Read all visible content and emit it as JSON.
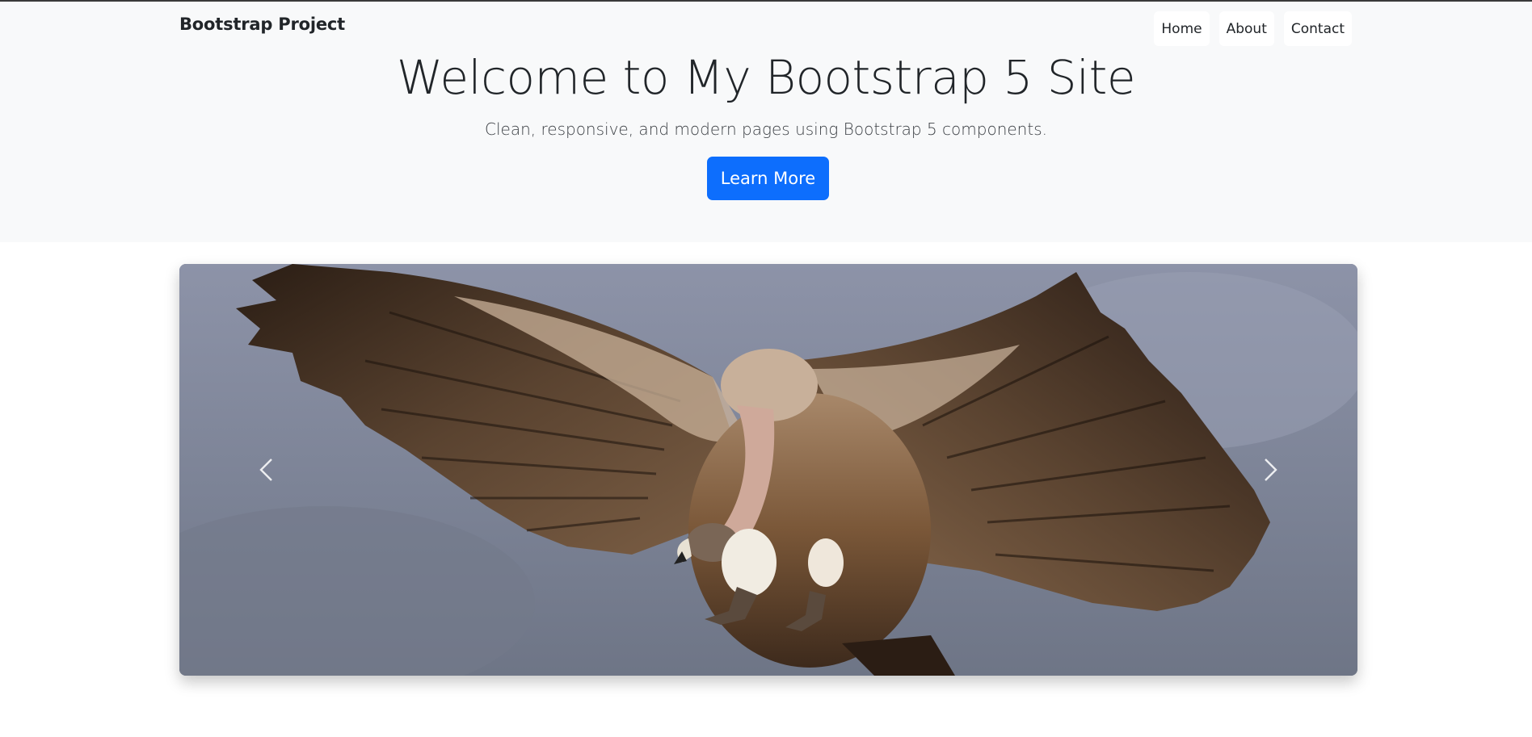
{
  "navbar": {
    "brand": "Bootstrap Project",
    "links": [
      "Home",
      "About",
      "Contact"
    ]
  },
  "hero": {
    "title": "Welcome to My Bootstrap 5 Site",
    "lead": "Clean, responsive, and modern pages using Bootstrap 5 components.",
    "button_label": "Learn More"
  },
  "carousel": {
    "slide_image": "vulture-in-flight",
    "prev_icon": "chevron-left-icon",
    "next_icon": "chevron-right-icon"
  },
  "colors": {
    "primary": "#0d6efd",
    "hero_bg": "#f8f9fa",
    "text": "#212529"
  }
}
